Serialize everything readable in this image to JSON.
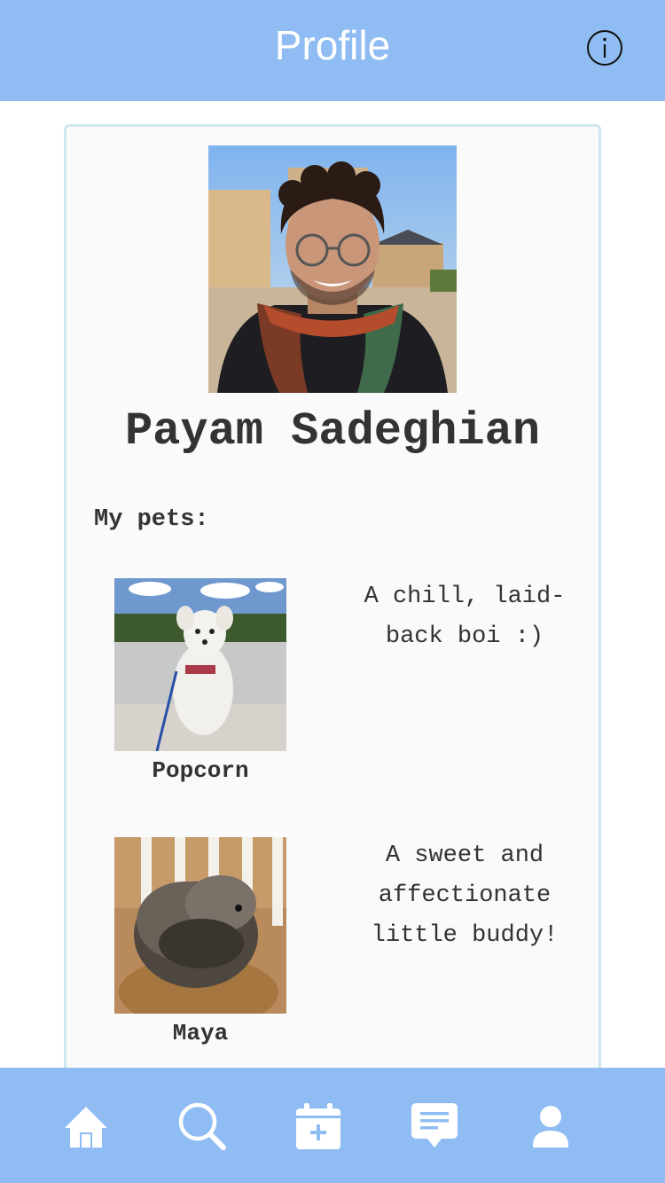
{
  "header": {
    "title": "Profile",
    "info_icon": "info-icon"
  },
  "profile": {
    "name": "Payam Sadeghian",
    "avatar": "profile-photo"
  },
  "pets_section": {
    "heading": "My pets:",
    "pets": [
      {
        "name": "Popcorn",
        "description": "A chill, laid-back boi :)",
        "photo": "white-dog-photo"
      },
      {
        "name": "Maya",
        "description": "A sweet and affectionate little buddy!",
        "photo": "gray-dog-photo"
      }
    ]
  },
  "tab_bar": {
    "tabs": [
      {
        "icon": "home-icon"
      },
      {
        "icon": "search-icon"
      },
      {
        "icon": "calendar-add-icon"
      },
      {
        "icon": "chat-icon"
      },
      {
        "icon": "profile-icon"
      }
    ]
  },
  "colors": {
    "bar": "#8fbcf2",
    "card_border": "#cfe6f1",
    "card_bg": "#fafafa",
    "text": "#333333"
  }
}
